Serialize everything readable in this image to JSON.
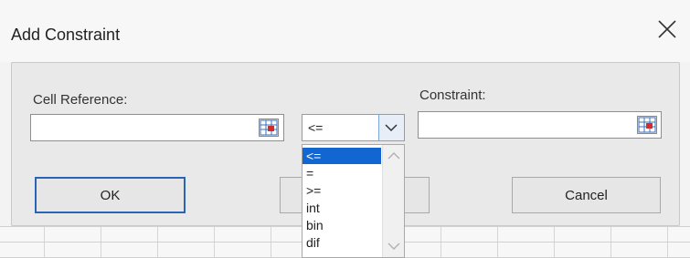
{
  "dialog": {
    "title": "Add Constraint",
    "close_icon": "close-icon"
  },
  "cell_reference": {
    "label": "Cell Reference:",
    "value": "",
    "ref_icon": "range-selector-icon"
  },
  "operator": {
    "selected": "<=",
    "options": [
      "<=",
      "=",
      ">=",
      "int",
      "bin",
      "dif"
    ],
    "arrow_icon": "chevron-down-icon"
  },
  "constraint": {
    "label": "Constraint:",
    "value": "",
    "ref_icon": "range-selector-icon"
  },
  "buttons": {
    "ok": "OK",
    "add": "",
    "cancel": "Cancel"
  },
  "colors": {
    "selection": "#1266d1",
    "default_button_border": "#2b63b5"
  }
}
